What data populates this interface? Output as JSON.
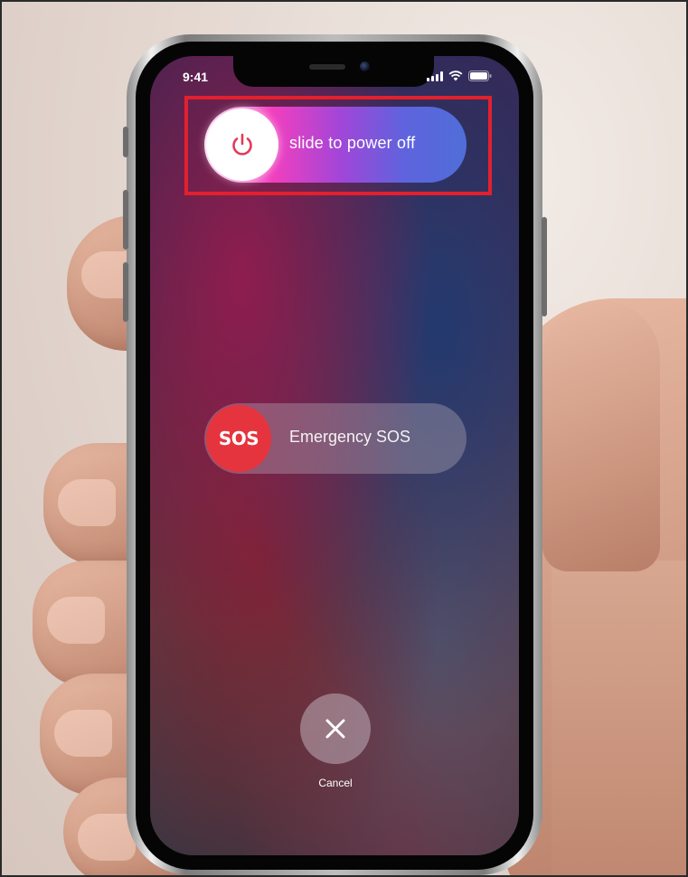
{
  "status_bar": {
    "time": "9:41",
    "signal_icon": "cellular-signal-icon",
    "wifi_icon": "wifi-icon",
    "battery_icon": "battery-icon"
  },
  "power_slider": {
    "label": "slide to power off",
    "knob_icon": "power-icon",
    "icon_color": "#e33a5b"
  },
  "sos_slider": {
    "knob_label": "SOS",
    "label": "Emergency SOS",
    "knob_color": "#e5343d"
  },
  "cancel": {
    "icon": "close-icon",
    "label": "Cancel"
  },
  "highlight": {
    "color": "#e3202d",
    "target": "power_slider"
  }
}
